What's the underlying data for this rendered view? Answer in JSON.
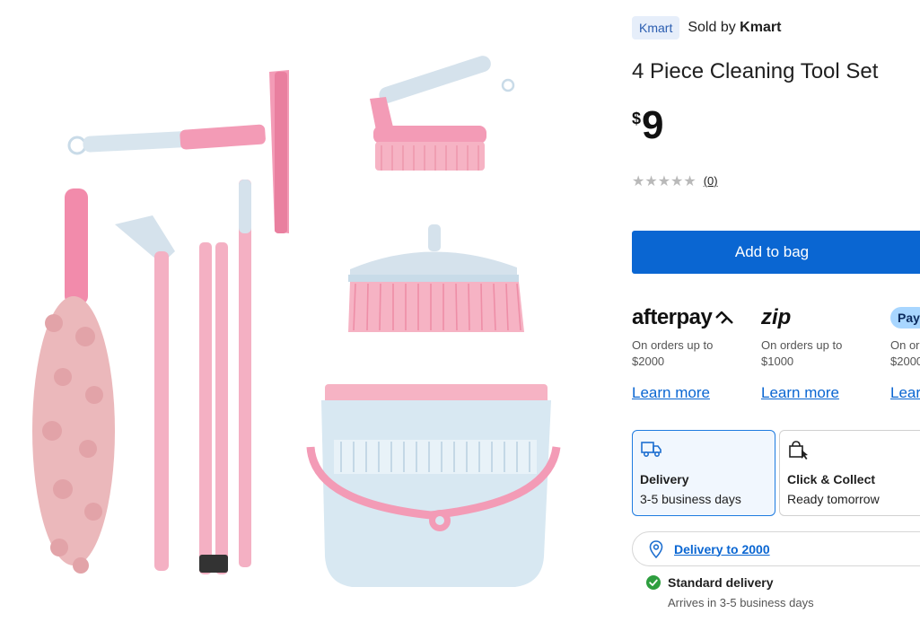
{
  "product": {
    "brand": "Kmart",
    "sold_by_prefix": "Sold by",
    "sold_by": "Kmart",
    "title": "4 Piece Cleaning Tool Set",
    "currency": "$",
    "price": "9",
    "rating": 0,
    "review_count": "(0)",
    "image_alt": "4 Piece Cleaning Tool Set"
  },
  "cart": {
    "add_label": "Add to bag"
  },
  "payments": [
    {
      "name": "afterpay",
      "note_line1": "On orders up to",
      "note_line2": "$2000",
      "link": "Learn more"
    },
    {
      "name": "zip",
      "note_line1": "On orders up to",
      "note_line2": "$1000",
      "link": "Learn more"
    },
    {
      "name": "Pay",
      "note_line1": "On or",
      "note_line2": "$2000",
      "link": "Lear"
    }
  ],
  "fulfilment": {
    "delivery": {
      "title": "Delivery",
      "subtitle": "3-5 business days",
      "icon": "truck-icon"
    },
    "collect": {
      "title": "Click & Collect",
      "subtitle": "Ready tomorrow",
      "icon": "bag-icon"
    },
    "location_link": "Delivery to 2000",
    "standard_title": "Standard delivery",
    "standard_sub": "Arrives in 3-5 business days"
  },
  "colors": {
    "accent": "#0a66d2",
    "pink": "#f2a6b8",
    "light_blue": "#cfe1ee",
    "success": "#2e9e3f"
  }
}
